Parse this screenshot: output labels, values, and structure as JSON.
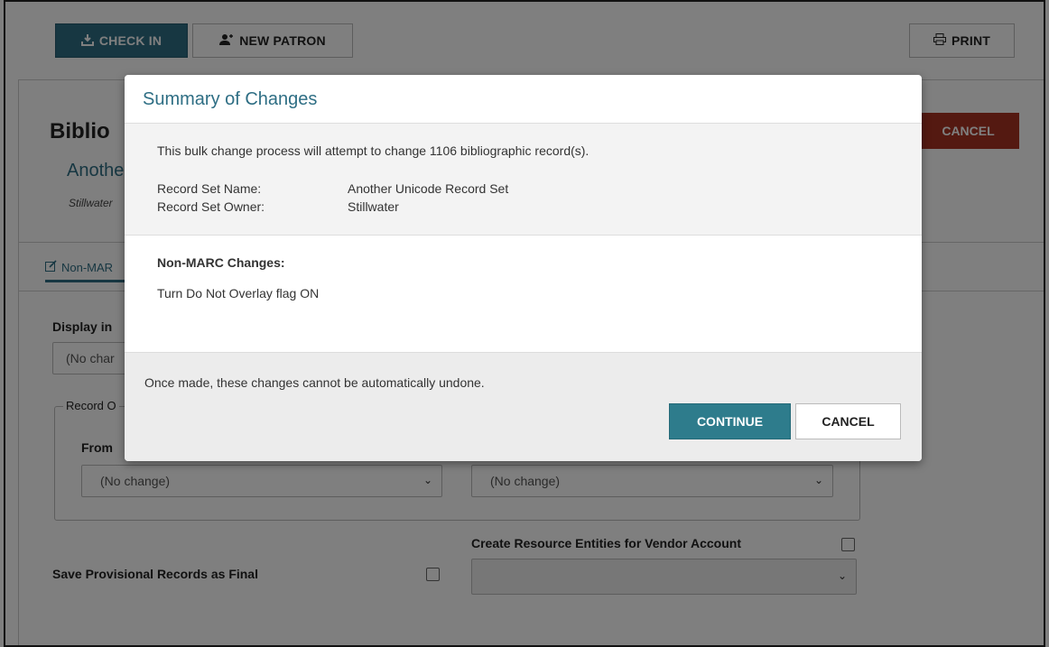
{
  "toolbar": {
    "check_in_label": "CHECK IN",
    "new_patron_label": "NEW PATRON",
    "print_label": "PRINT"
  },
  "page": {
    "title": "Biblio",
    "subtitle": "Anothe",
    "owner": "Stillwater",
    "cancel_label": "CANCEL",
    "tab_label": "Non-MAR",
    "display_label": "Display in",
    "display_value": "(No char",
    "record_owner_legend": "Record O",
    "from_label": "From",
    "from_select_value": "(No change)",
    "to_select_value": "(No change)",
    "create_resource_label": "Create Resource Entities for Vendor Account",
    "save_provisional_label": "Save Provisional Records as Final"
  },
  "modal": {
    "title": "Summary of Changes",
    "intro": "This bulk change process will attempt to change 1106 bibliographic record(s).",
    "record_set_name_label": "Record Set Name:",
    "record_set_name_value": "Another Unicode Record Set",
    "record_set_owner_label": "Record Set Owner:",
    "record_set_owner_value": "Stillwater",
    "nonmarc_heading": "Non-MARC Changes:",
    "nonmarc_item": "Turn Do Not Overlay flag ON",
    "warning": "Once made, these changes cannot be automatically undone.",
    "continue_label": "CONTINUE",
    "cancel_label": "CANCEL"
  },
  "colors": {
    "accent": "#2e6e84",
    "danger": "#a83222",
    "overlay": "rgba(0,0,0,0.5)"
  }
}
